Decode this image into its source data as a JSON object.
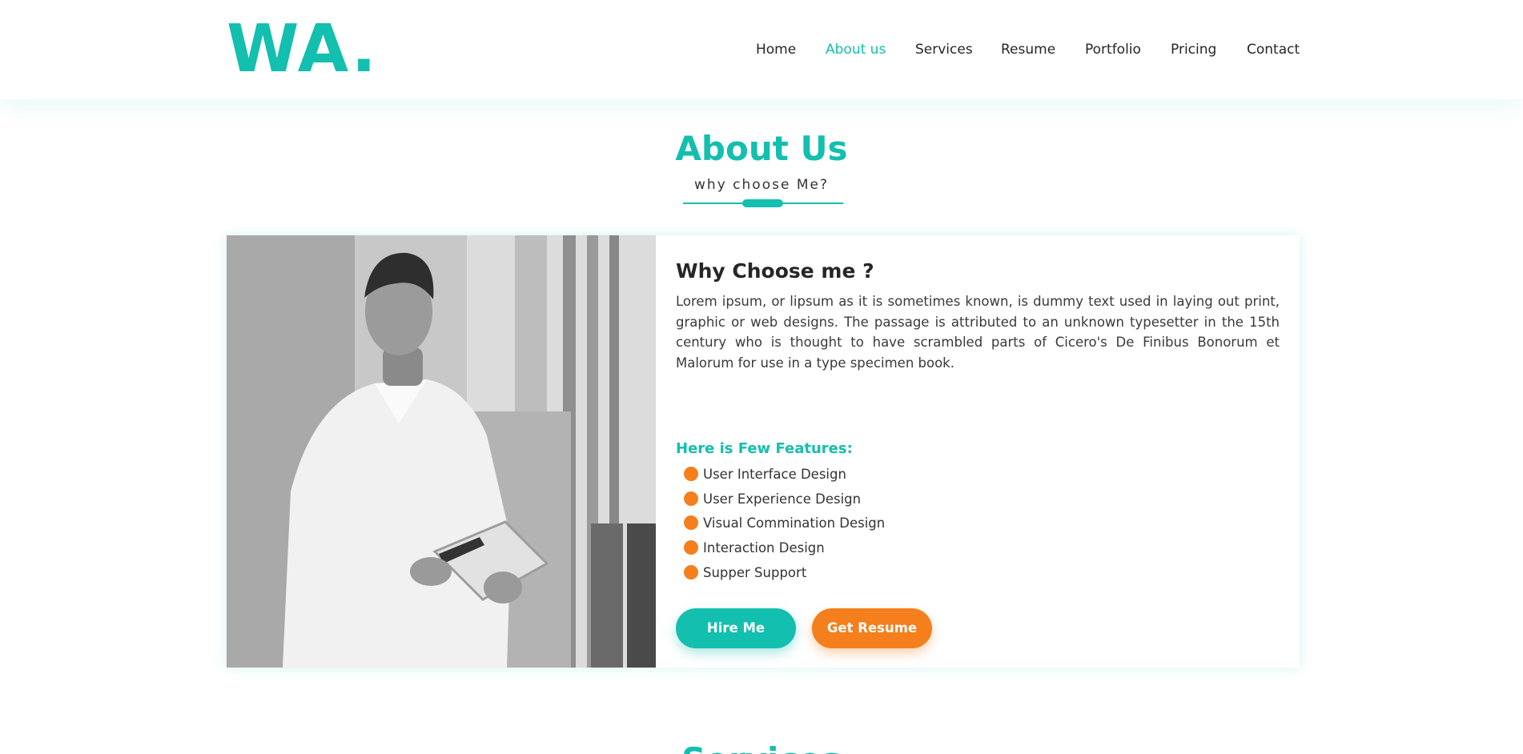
{
  "header": {
    "logo": "WA.",
    "nav": [
      {
        "label": "Home",
        "active": false
      },
      {
        "label": "About us",
        "active": true
      },
      {
        "label": "Services",
        "active": false
      },
      {
        "label": "Resume",
        "active": false
      },
      {
        "label": "Portfolio",
        "active": false
      },
      {
        "label": "Pricing",
        "active": false
      },
      {
        "label": "Contact",
        "active": false
      }
    ]
  },
  "about": {
    "title": "About Us",
    "subtitle": "why choose Me?",
    "heading": "Why Choose me ?",
    "paragraph": "Lorem ipsum, or lipsum as it is sometimes known, is dummy text used in laying out print, graphic or web designs. The passage is attributed to an unknown typesetter in the 15th century who is thought to have scrambled parts of Cicero's De Finibus Bonorum et Malorum for use in a type specimen book.",
    "features_title": "Here is Few Features:",
    "features": [
      "User Interface Design",
      "User Experience Design",
      "Visual Commination Design",
      "Interaction Design",
      "Supper Support"
    ],
    "hire_label": "Hire Me",
    "resume_label": "Get Resume",
    "photo_icon": "person-photo"
  },
  "next_section": {
    "title": "Services"
  },
  "colors": {
    "accent": "#13bfae",
    "secondary": "#f47f1c",
    "text": "#262626"
  }
}
